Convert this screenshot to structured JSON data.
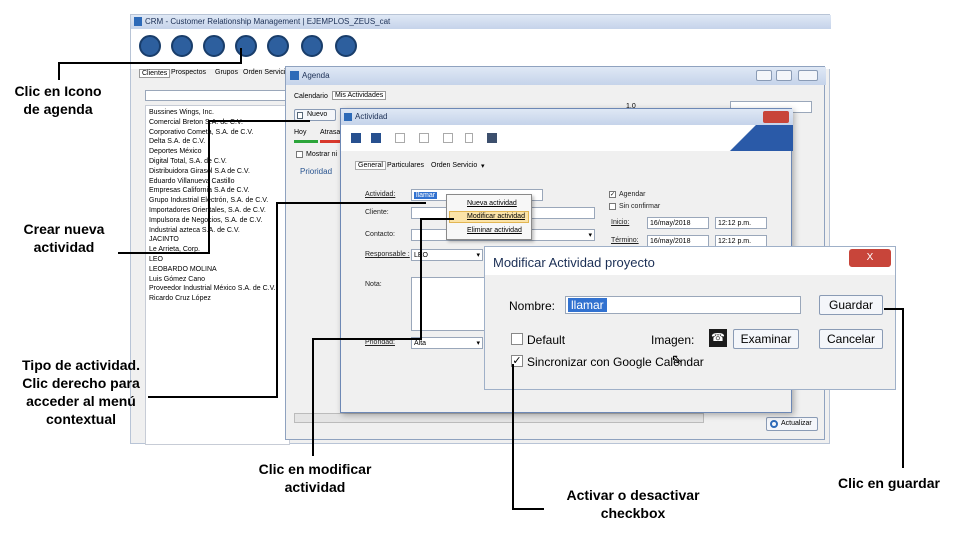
{
  "app": {
    "title": "CRM - Customer Relationship Management | EJEMPLOS_ZEUS_cat"
  },
  "left_tabs": [
    "Clientes",
    "Prospectos",
    "Grupos",
    "Orden Servicio"
  ],
  "clients": [
    "Bussines Wings, Inc.",
    "Comercial Breton S.A. de C.V.",
    "Corporativo Cometa, S.A. de C.V.",
    "Delta S.A. de C.V.",
    "Deportes México",
    "Digital Total, S.A. de C.V.",
    "Distribuidora Girasol S.A de C.V.",
    "Eduardo Villanueva Castillo",
    "Empresas California S.A de C.V.",
    "Grupo Industrial Electrón, S.A. de C.V.",
    "Importadores Orientales, S.A. de C.V.",
    "Impulsora de Negocios, S.A. de C.V.",
    "Industrial azteca S.A. de C.V.",
    "JACINTO",
    "Le Arrieta, Corp.",
    "LEO",
    "LEOBARDO MOLINA",
    "Luis Gómez Cano",
    "Proveedor Industrial México S.A. de C.V.",
    "Ricardo Cruz López"
  ],
  "agenda": {
    "title": "Agenda",
    "tabs": [
      "Calendario",
      "Mis Actividades"
    ],
    "new_btn": "Nuevo",
    "sub_tabs": [
      "Hoy",
      "Atrasa"
    ],
    "show_label": "Mostrar ni",
    "priority_label": "Prioridad",
    "refresh_btn": "Actualizar",
    "right_combo": "",
    "date_label": "1.0"
  },
  "actividad": {
    "title": "Actividad",
    "tabs": [
      "General",
      "Particulares",
      "Orden Servicio"
    ],
    "actividad_label": "Actividad:",
    "actividad_value": "llamar",
    "cliente_label": "Cliente:",
    "contacto_label": "Contacto:",
    "responsable_label": "Responsable :",
    "responsable_value": "LEO",
    "nota_label": "Nota:",
    "prioridad_label": "Prioridad:",
    "prioridad_value": "Alta",
    "agendar_label": "Agendar",
    "sin_confirmar_label": "Sin confirmar",
    "inicio_label": "Inicio:",
    "inicio_date": "16/may/2018",
    "inicio_time": "12:12 p.m.",
    "termino_label": "Término:",
    "termino_date": "16/may/2018",
    "termino_time": "12:12 p.m."
  },
  "context_menu": {
    "items": [
      "Nueva actividad",
      "Modificar actividad",
      "Eliminar actividad"
    ]
  },
  "modificar": {
    "title": "Modificar Actividad proyecto",
    "nombre_label": "Nombre:",
    "nombre_value": "llamar",
    "default_label": "Default",
    "imagen_label": "Imagen:",
    "examinar_btn": "Examinar",
    "sync_label": "Sincronizar con Google Calendar",
    "guardar_btn": "Guardar",
    "cancelar_btn": "Cancelar",
    "close_btn": "X"
  },
  "annotations": {
    "icono_agenda": "Clic en Icono de agenda",
    "crear": "Crear nueva actividad",
    "tipo": "Tipo de actividad. Clic derecho para acceder al menú contextual",
    "modificar": "Clic en modificar actividad",
    "checkbox": "Activar o desactivar checkbox",
    "guardar": "Clic en guardar"
  }
}
